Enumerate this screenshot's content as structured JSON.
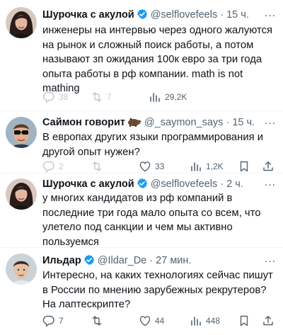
{
  "tweets": [
    {
      "name": "Шурочка с акулой",
      "handle": "@selflovefeels",
      "separator": "·",
      "time": "15 ч.",
      "menu": "...",
      "lines": [
        "инженеры на интервью через одного жалуются",
        "на рынок и сложный поиск работы, а потом",
        "называют зп ожидания 100к евро за три года",
        "опыта работы в рф компании. math is not",
        "mathing"
      ],
      "actions": {
        "replies": "38",
        "retweets": "7",
        "likes": "",
        "views": "29,2K"
      },
      "avatar": "woman-dark-hair"
    },
    {
      "name": "Саймон говорит",
      "handle": "@_saymon_says",
      "separator": "·",
      "time": "15 ч.",
      "menu": "...",
      "lines": [
        "В европах других языки программирования и",
        "другой опыт нужен?"
      ],
      "actions": {
        "replies": "2",
        "retweets": "",
        "likes": "33",
        "views": "1,2K"
      },
      "avatar": "man-sunglasses"
    },
    {
      "name": "Шурочка с акулой",
      "handle": "@selflovefeels",
      "separator": "·",
      "time": "2 ч.",
      "menu": "...",
      "lines": [
        "у многих кандидатов из рф компаний в",
        "последние три года мало опыта со всем, что",
        "улетело под санкции и чем мы активно",
        "пользуемся"
      ],
      "actions": {
        "replies": "",
        "retweets": "",
        "likes": "",
        "views": ""
      },
      "avatar": "woman-dark-hair"
    },
    {
      "name": "Ильдар",
      "handle": "@Ildar_De",
      "separator": "·",
      "time": "27 мин.",
      "menu": "...",
      "lines": [
        "Интересно, на каких технологиях сейчас пишут",
        "в России по мнению зарубежных рекрутеров?",
        "На лаптескрипте?"
      ],
      "actions": {
        "replies": "7",
        "retweets": "",
        "likes": "44",
        "views": "448"
      },
      "avatar": "man-short-hair"
    }
  ],
  "colors": {
    "text": "#0f1419",
    "secondary": "#536471",
    "verified": "#1d9bf0",
    "divider": "#eff3f4"
  }
}
